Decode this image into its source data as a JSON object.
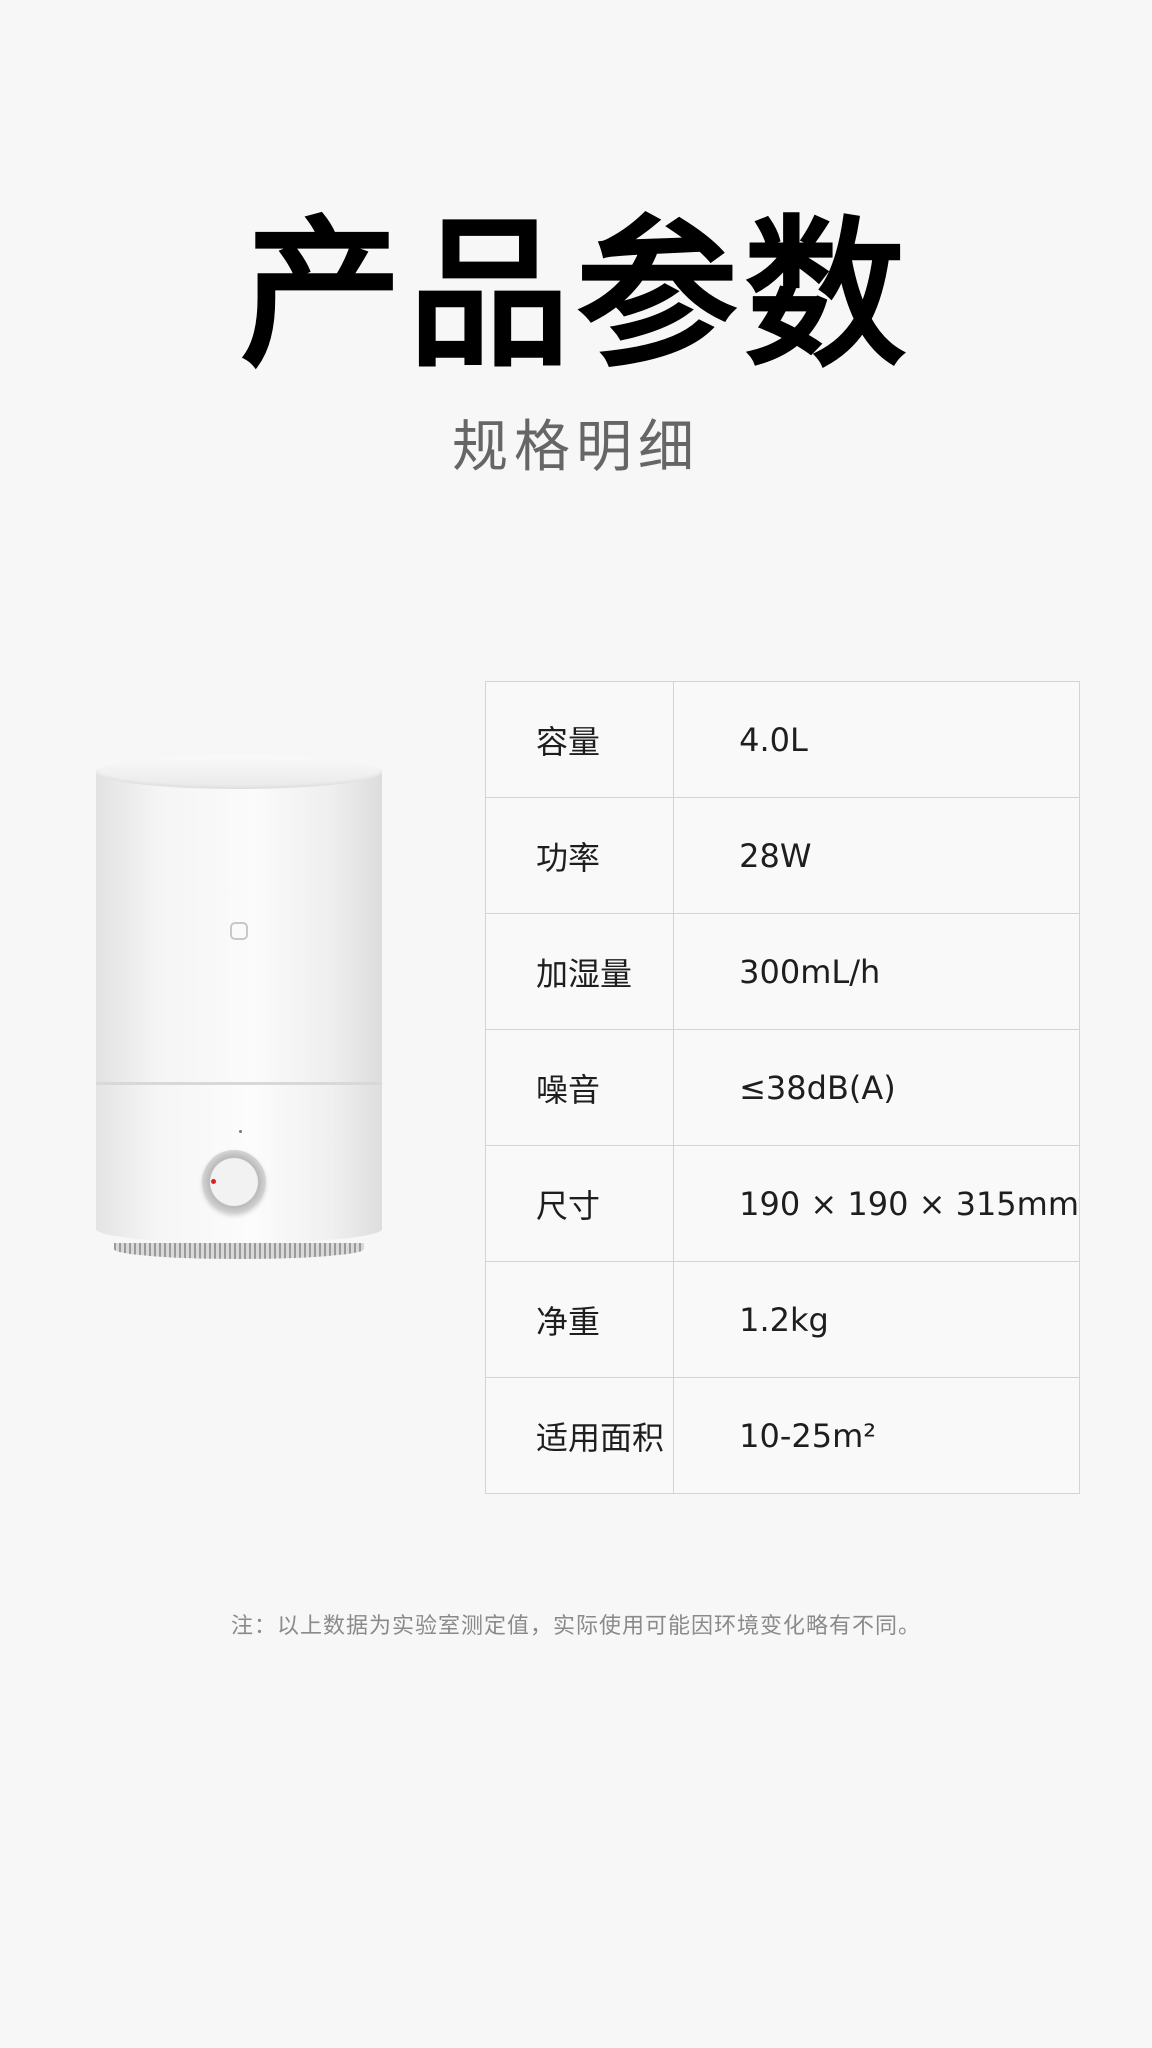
{
  "header": {
    "title": "产品参数",
    "subtitle": "规格明细"
  },
  "specs": [
    {
      "label": "容量",
      "value": "4.0L"
    },
    {
      "label": "功率",
      "value": "28W"
    },
    {
      "label": "加湿量",
      "value": "300mL/h"
    },
    {
      "label": "噪音",
      "value": "≤38dB(A)"
    },
    {
      "label": "尺寸",
      "value": "190 × 190 × 315mm"
    },
    {
      "label": "净重",
      "value": "1.2kg"
    },
    {
      "label": "适用面积",
      "value": "10-25m²"
    }
  ],
  "footnote": "注：以上数据为实验室测定值，实际使用可能因环境变化略有不同。",
  "colors": {
    "background": "#f7f7f7",
    "border": "#d4d4d4",
    "knob_led": "#e02020"
  }
}
